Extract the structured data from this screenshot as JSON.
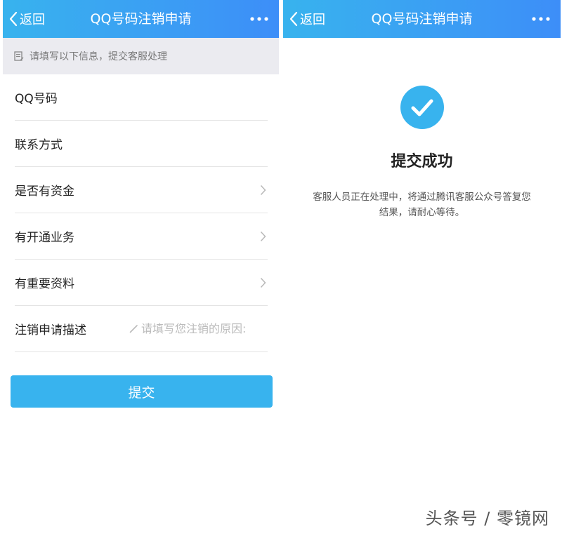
{
  "left_screen": {
    "nav": {
      "back_label": "返回",
      "title": "QQ号码注销申请",
      "more_icon": "more-dots-icon"
    },
    "notice": {
      "icon": "edit-note-icon",
      "text": "请填写以下信息，提交客服处理"
    },
    "rows": [
      {
        "label": "QQ号码",
        "has_arrow": false
      },
      {
        "label": "联系方式",
        "has_arrow": false
      },
      {
        "label": "是否有资金",
        "has_arrow": true
      },
      {
        "label": "有开通业务",
        "has_arrow": true
      },
      {
        "label": "有重要资料",
        "has_arrow": true
      },
      {
        "label": "注销申请描述",
        "placeholder": "请填写您注销的原因:"
      }
    ],
    "submit_label": "提交"
  },
  "right_screen": {
    "nav": {
      "back_label": "返回",
      "title": "QQ号码注销申请",
      "more_icon": "more-dots-icon"
    },
    "success_icon": "check-circle-icon",
    "success_title": "提交成功",
    "success_line1": "客服人员正在处理中，将通过腾讯客服公众号答复您",
    "success_line2": "结果，请耐心等待。"
  },
  "watermark": "头条号 / 零镜网",
  "colors": {
    "nav_gradient_start": "#38b3ee",
    "nav_gradient_end": "#3d8ef8",
    "button": "#38b3ee",
    "check_circle": "#38b3ee",
    "notice_bg": "#ebebf0"
  }
}
